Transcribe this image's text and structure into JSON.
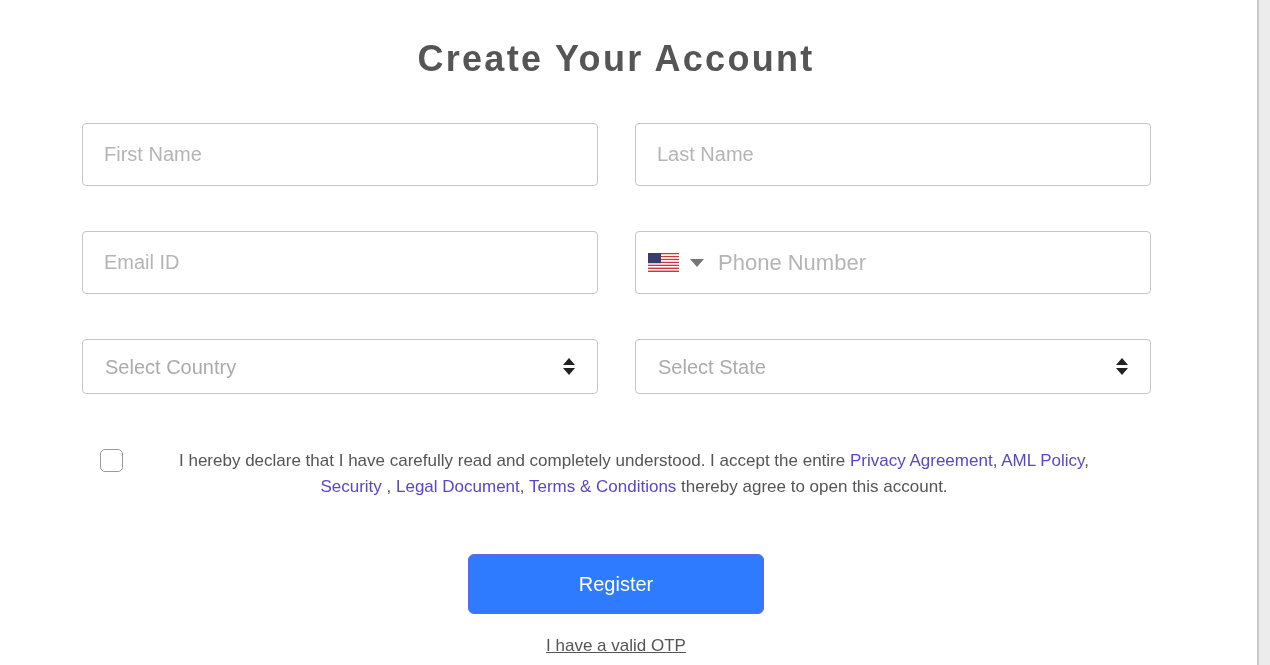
{
  "title": "Create Your Account",
  "fields": [
    {
      "kind": "text",
      "placeholder": "First Name"
    },
    {
      "kind": "text",
      "placeholder": "Last Name"
    },
    {
      "kind": "text",
      "placeholder": "Email ID"
    },
    {
      "kind": "phone",
      "placeholder": "Phone Number"
    },
    {
      "kind": "select",
      "placeholder": "Select Country"
    },
    {
      "kind": "select",
      "placeholder": "Select State"
    }
  ],
  "agreement": {
    "checked": false,
    "segments": [
      {
        "kind": "text",
        "text": "I hereby declare that I have carefully read and completely understood. I accept the entire "
      },
      {
        "kind": "link",
        "text": "Privacy Agreement"
      },
      {
        "kind": "text",
        "text": ", "
      },
      {
        "kind": "link",
        "text": "AML Policy"
      },
      {
        "kind": "text",
        "text": ", "
      },
      {
        "kind": "link",
        "text": "Security"
      },
      {
        "kind": "text",
        "text": " , "
      },
      {
        "kind": "link",
        "text": "Legal Document"
      },
      {
        "kind": "text",
        "text": ", "
      },
      {
        "kind": "link",
        "text": "Terms & Conditions"
      },
      {
        "kind": "text",
        "text": " thereby agree to open this account."
      }
    ]
  },
  "register_button": "Register",
  "otp_link": "I have a valid OTP"
}
